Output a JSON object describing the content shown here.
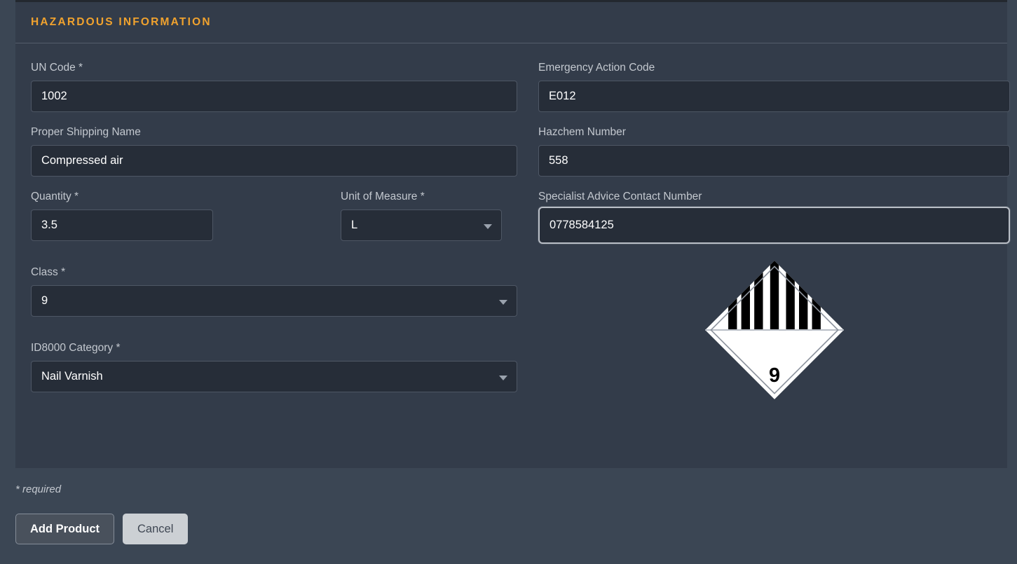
{
  "card": {
    "title": "Hazardous Information",
    "fields": {
      "un_code": {
        "label": "UN Code *",
        "value": "1002",
        "placeholder": ""
      },
      "emergency_action_code": {
        "label": "Emergency Action Code",
        "value": "E012",
        "placeholder": ""
      },
      "proper_shipping_name": {
        "label": "Proper Shipping Name",
        "value": "Compressed air",
        "placeholder": ""
      },
      "hazchem_number": {
        "label": "Hazchem Number",
        "value": "558",
        "placeholder": ""
      },
      "quantity": {
        "label": "Quantity *",
        "value": "3.5",
        "placeholder": ""
      },
      "unit_of_measure": {
        "label": "Unit of Measure *",
        "value": "L",
        "placeholder": ""
      },
      "specialist_advice_contact_number": {
        "label": "Specialist Advice Contact Number",
        "value": "0778584125",
        "placeholder": ""
      },
      "class": {
        "label": "Class *",
        "value": "9",
        "placeholder": ""
      },
      "id8000_category": {
        "label": "ID8000 Category *",
        "value": "Nail Varnish",
        "placeholder": ""
      }
    },
    "placard": {
      "icon": "hazard-class-9-placard",
      "class_number": "9",
      "stripe_count": 7,
      "colors": {
        "background": "#ffffff",
        "stripes": "#000000",
        "text": "#000000"
      }
    }
  },
  "footer": {
    "required_note": "* required",
    "add_product_label": "Add Product",
    "cancel_label": "Cancel"
  },
  "colors": {
    "accent_title": "#f0a22e",
    "page_background": "#3b4654",
    "card_background": "#333c4a",
    "input_background": "#262d38",
    "focus_border": "#b9bec6",
    "primary_button": "#49515c",
    "secondary_button": "#ccd0d4"
  }
}
